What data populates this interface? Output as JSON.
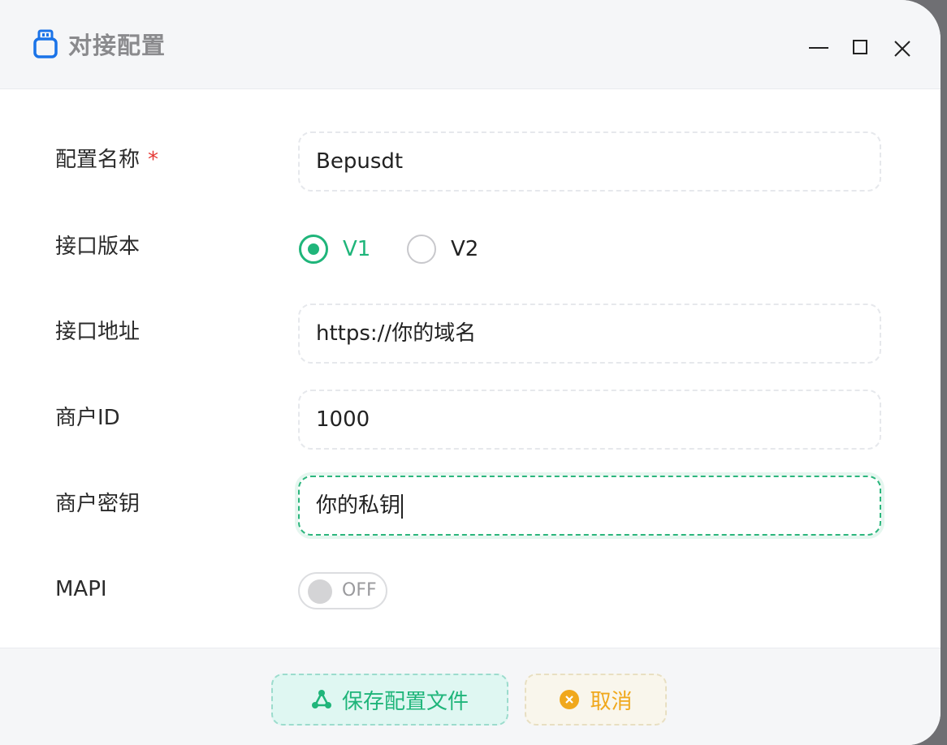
{
  "window": {
    "title": "对接配置",
    "icon": "usb-plug-icon",
    "controls": [
      "minimize-icon",
      "maximize-icon",
      "close-icon"
    ]
  },
  "form": {
    "config_name": {
      "label": "配置名称",
      "required_mark": "*",
      "value": "Bepusdt"
    },
    "api_version": {
      "label": "接口版本",
      "options": [
        {
          "label": "V1",
          "checked": true
        },
        {
          "label": "V2",
          "checked": false
        }
      ]
    },
    "api_url": {
      "label": "接口地址",
      "value": "https://你的域名"
    },
    "merchant_id": {
      "label": "商户ID",
      "value": "1000"
    },
    "merchant_key": {
      "label": "商户密钥",
      "value": "你的私钥",
      "focused": true
    },
    "mapi": {
      "label": "MAPI",
      "state_text": "OFF",
      "enabled": false
    }
  },
  "footer": {
    "save_label": "保存配置文件",
    "save_icon": "share-nodes-icon",
    "cancel_label": "取消",
    "cancel_icon": "close-circle-icon"
  },
  "colors": {
    "accent_green": "#1fb57a",
    "required_red": "#e53935",
    "cancel_orange": "#f0a81c",
    "title_icon_blue": "#1a73e8"
  }
}
